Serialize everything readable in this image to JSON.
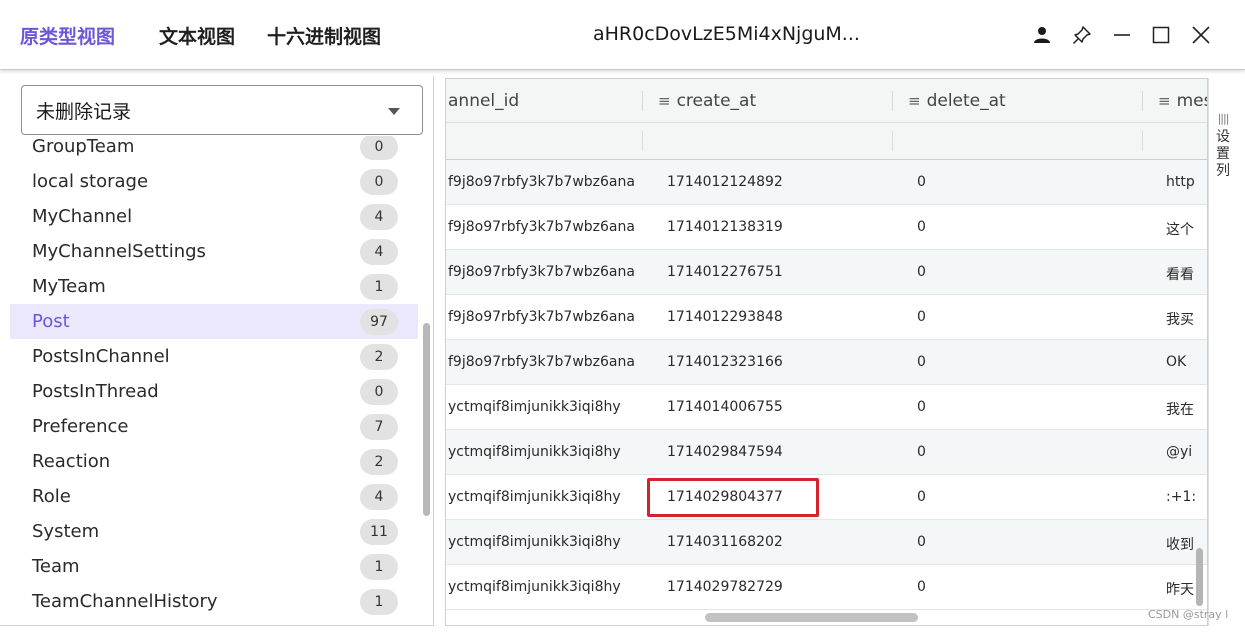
{
  "header": {
    "tabs": [
      {
        "label": "原类型视图",
        "active": true
      },
      {
        "label": "文本视图",
        "active": false
      },
      {
        "label": "十六进制视图",
        "active": false
      }
    ],
    "window_title": "aHR0cDovLzE5Mi4xNjguM...",
    "accent_color": "#6f56d9"
  },
  "sidebar": {
    "filter_select": "未删除记录",
    "items": [
      {
        "name": "GroupTeam",
        "count": "0"
      },
      {
        "name": "local storage",
        "count": "0"
      },
      {
        "name": "MyChannel",
        "count": "4"
      },
      {
        "name": "MyChannelSettings",
        "count": "4"
      },
      {
        "name": "MyTeam",
        "count": "1"
      },
      {
        "name": "Post",
        "count": "97",
        "selected": true
      },
      {
        "name": "PostsInChannel",
        "count": "2"
      },
      {
        "name": "PostsInThread",
        "count": "0"
      },
      {
        "name": "Preference",
        "count": "7"
      },
      {
        "name": "Reaction",
        "count": "2"
      },
      {
        "name": "Role",
        "count": "4"
      },
      {
        "name": "System",
        "count": "11"
      },
      {
        "name": "Team",
        "count": "1"
      },
      {
        "name": "TeamChannelHistory",
        "count": "1"
      }
    ]
  },
  "grid": {
    "columns": [
      "annel_id",
      "create_at",
      "delete_at",
      "mes"
    ],
    "rows": [
      [
        "f9j8o97rbfy3k7b7wbz6ana",
        "1714012124892",
        "0",
        "http"
      ],
      [
        "f9j8o97rbfy3k7b7wbz6ana",
        "1714012138319",
        "0",
        "这个"
      ],
      [
        "f9j8o97rbfy3k7b7wbz6ana",
        "1714012276751",
        "0",
        "看看"
      ],
      [
        "f9j8o97rbfy3k7b7wbz6ana",
        "1714012293848",
        "0",
        "我买"
      ],
      [
        "f9j8o97rbfy3k7b7wbz6ana",
        "1714012323166",
        "0",
        "OK"
      ],
      [
        "yctmqif8imjunikk3iqi8hy",
        "1714014006755",
        "0",
        "我在"
      ],
      [
        "yctmqif8imjunikk3iqi8hy",
        "1714029847594",
        "0",
        "@yi"
      ],
      [
        "yctmqif8imjunikk3iqi8hy",
        "1714029804377",
        "0",
        ":+1:"
      ],
      [
        "yctmqif8imjunikk3iqi8hy",
        "1714031168202",
        "0",
        "收到"
      ],
      [
        "yctmqif8imjunikk3iqi8hy",
        "1714029782729",
        "0",
        "昨天"
      ]
    ],
    "highlighted_value": "1714029804377",
    "side_panel_label": [
      "设",
      "置",
      "列"
    ]
  },
  "watermark": "CSDN @stray l"
}
